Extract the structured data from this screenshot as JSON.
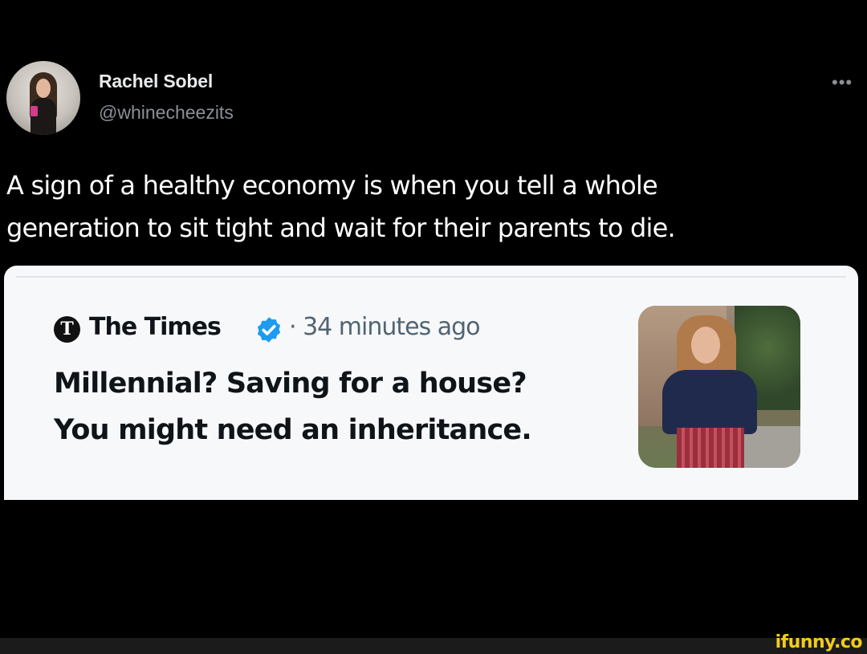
{
  "tweet": {
    "author_name": "Rachel Sobel",
    "author_handle": "@whinecheezits",
    "more_icon": "more-horizontal-icon",
    "text_line1": "A sign of a healthy economy is when you tell a whole",
    "text_line2": "generation to sit tight and wait for their parents to die."
  },
  "quote": {
    "source_logo_letter": "T",
    "source_name": "The Times",
    "verified_icon": "verified-badge-icon",
    "time": "· 34 minutes ago",
    "headline_line1": "Millennial? Saving for a house?",
    "headline_line2": "You might need an inheritance."
  },
  "watermark": {
    "text": "ifunny.co"
  },
  "colors": {
    "background": "#000000",
    "card_background": "#f6f8fa",
    "verified_blue": "#1d9bf0",
    "watermark_yellow": "#f2cb1d",
    "secondary_text": "#8b9096"
  }
}
